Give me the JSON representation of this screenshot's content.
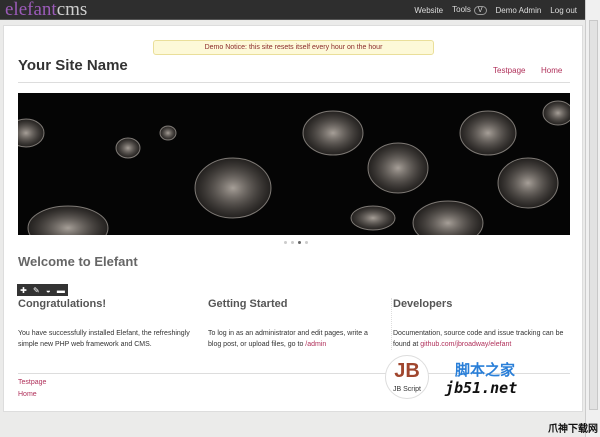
{
  "topbar": {
    "logo_main": "elefant",
    "logo_suffix": "cms",
    "links": [
      "Website",
      "Tools",
      "Demo Admin",
      "Log out"
    ],
    "tools_badge": "V"
  },
  "notice": "Demo Notice: this site resets itself every hour on the hour",
  "header": {
    "site_name": "Your Site Name",
    "nav": [
      "Testpage",
      "Home"
    ]
  },
  "slider": {
    "dots": 4,
    "active": 3
  },
  "page": {
    "title": "Welcome to Elefant",
    "toolbar": [
      "add",
      "edit",
      "comment",
      "remove"
    ]
  },
  "columns": [
    {
      "title": "Congratulations!",
      "text": "You have successfully installed Elefant, the refreshingly simple new PHP web framework and CMS."
    },
    {
      "title": "Getting Started",
      "text": "To log in as an administrator and edit pages, write a blog post, or upload files, go to ",
      "link": "/admin"
    },
    {
      "title": "Developers",
      "text": "Documentation, source code and issue tracking can be found at ",
      "link": "github.com/jbroadway/elefant"
    }
  ],
  "footer": {
    "links": [
      "Testpage",
      "Home"
    ]
  },
  "watermark": {
    "brand": "脚本之家",
    "site": "jb51.net",
    "logo": "JB Script"
  },
  "credit": "爪神下载网"
}
